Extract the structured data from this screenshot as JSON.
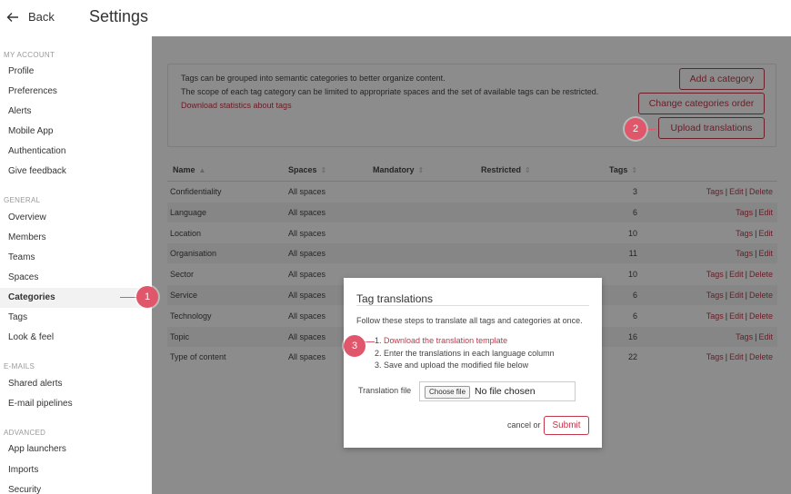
{
  "header": {
    "back_label": "Back",
    "title": "Settings"
  },
  "sidebar": {
    "sections": [
      {
        "title": "MY ACCOUNT",
        "items": [
          "Profile",
          "Preferences",
          "Alerts",
          "Mobile App",
          "Authentication",
          "Give feedback"
        ]
      },
      {
        "title": "GENERAL",
        "items": [
          "Overview",
          "Members",
          "Teams",
          "Spaces",
          "Categories",
          "Tags",
          "Look & feel"
        ]
      },
      {
        "title": "E-MAILS",
        "items": [
          "Shared alerts",
          "E-mail pipelines"
        ]
      },
      {
        "title": "ADVANCED",
        "items": [
          "App launchers",
          "Imports",
          "Security"
        ]
      }
    ],
    "active": "Categories"
  },
  "info": {
    "line1": "Tags can be grouped into semantic categories to better organize content.",
    "line2": "The scope of each tag category can be limited to appropriate spaces and the set of available tags can be restricted.",
    "link": "Download statistics about tags"
  },
  "buttons": {
    "add_category": "Add a category",
    "change_order": "Change categories order",
    "upload": "Upload translations"
  },
  "table": {
    "headers": {
      "name": "Name",
      "spaces": "Spaces",
      "mandatory": "Mandatory",
      "restricted": "Restricted",
      "tags": "Tags"
    },
    "sort_up": "▲",
    "sort_both": "⇕",
    "rows": [
      {
        "name": "Confidentiality",
        "spaces": "All spaces",
        "tags": "3",
        "actions": [
          "Tags",
          "Edit",
          "Delete"
        ]
      },
      {
        "name": "Language",
        "spaces": "All spaces",
        "tags": "6",
        "actions": [
          "Tags",
          "Edit"
        ]
      },
      {
        "name": "Location",
        "spaces": "All spaces",
        "tags": "10",
        "actions": [
          "Tags",
          "Edit"
        ]
      },
      {
        "name": "Organisation",
        "spaces": "All spaces",
        "tags": "11",
        "actions": [
          "Tags",
          "Edit"
        ]
      },
      {
        "name": "Sector",
        "spaces": "All spaces",
        "tags": "10",
        "actions": [
          "Tags",
          "Edit",
          "Delete"
        ]
      },
      {
        "name": "Service",
        "spaces": "All spaces",
        "tags": "6",
        "actions": [
          "Tags",
          "Edit",
          "Delete"
        ]
      },
      {
        "name": "Technology",
        "spaces": "All spaces",
        "tags": "6",
        "actions": [
          "Tags",
          "Edit",
          "Delete"
        ]
      },
      {
        "name": "Topic",
        "spaces": "All spaces",
        "tags": "16",
        "actions": [
          "Tags",
          "Edit"
        ]
      },
      {
        "name": "Type of content",
        "spaces": "All spaces",
        "tags": "22",
        "actions": [
          "Tags",
          "Edit",
          "Delete"
        ]
      }
    ]
  },
  "modal": {
    "title": "Tag translations",
    "intro": "Follow these steps to translate all tags and categories at once.",
    "step1_prefix": "1.",
    "step1_link": "Download the translation template",
    "step2": "2. Enter the translations in each language column",
    "step3": "3. Save and upload the modified file below",
    "file_label": "Translation file",
    "file_button": "Choose file",
    "file_status": "No file chosen",
    "cancel": "cancel",
    "or": "or",
    "submit": "Submit"
  },
  "callouts": [
    "1",
    "2",
    "3"
  ],
  "colors": {
    "accent": "#c4364a",
    "callout": "#e0566a"
  },
  "icons": {
    "back": "arrow-left-icon"
  }
}
